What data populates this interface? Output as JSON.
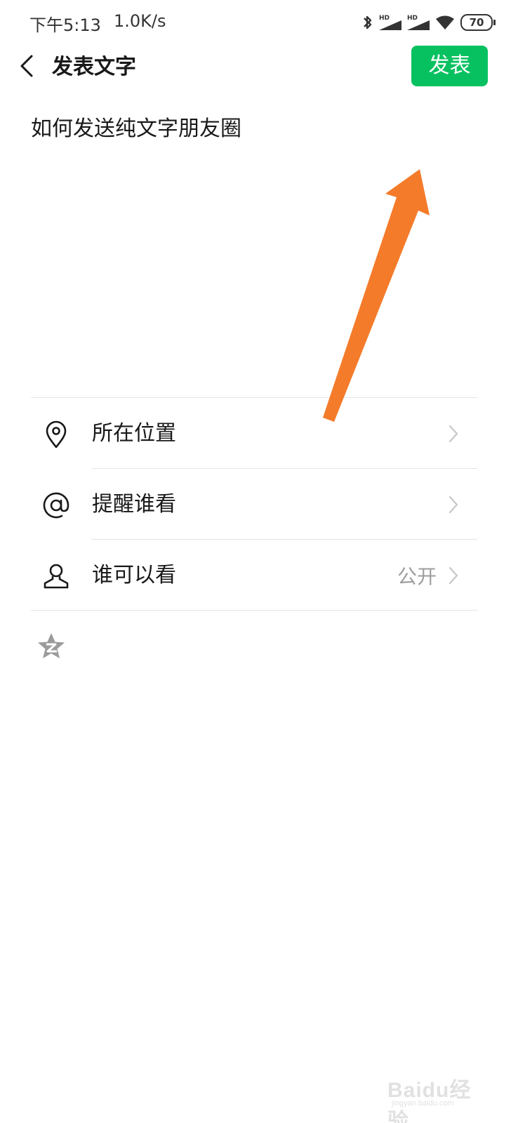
{
  "status_bar": {
    "time": "下午5:13",
    "network_speed": "1.0K/s",
    "battery_level": "70",
    "icons": [
      "bluetooth-icon",
      "signal-hd-icon",
      "signal-hd-icon",
      "wifi-icon",
      "battery-icon"
    ]
  },
  "nav": {
    "title": "发表文字",
    "back_icon": "chevron-left-icon",
    "publish_label": "发表"
  },
  "editor": {
    "text": "如何发送纯文字朋友圈"
  },
  "options": [
    {
      "icon": "location-pin-icon",
      "label": "所在位置",
      "value": ""
    },
    {
      "icon": "at-sign-icon",
      "label": "提醒谁看",
      "value": ""
    },
    {
      "icon": "person-icon",
      "label": "谁可以看",
      "value": "公开"
    }
  ],
  "share_target": {
    "icon": "qzone-star-icon"
  },
  "annotation": {
    "icon": "orange-arrow",
    "color": "#f47b2a"
  },
  "watermark": {
    "text": "Baidu经验",
    "url": "jingyan.baidu.com"
  },
  "colors": {
    "brand_green": "#07c160",
    "divider": "#e5e5e5",
    "secondary_text": "#9e9e9e",
    "annotation_orange": "#f47b2a"
  }
}
